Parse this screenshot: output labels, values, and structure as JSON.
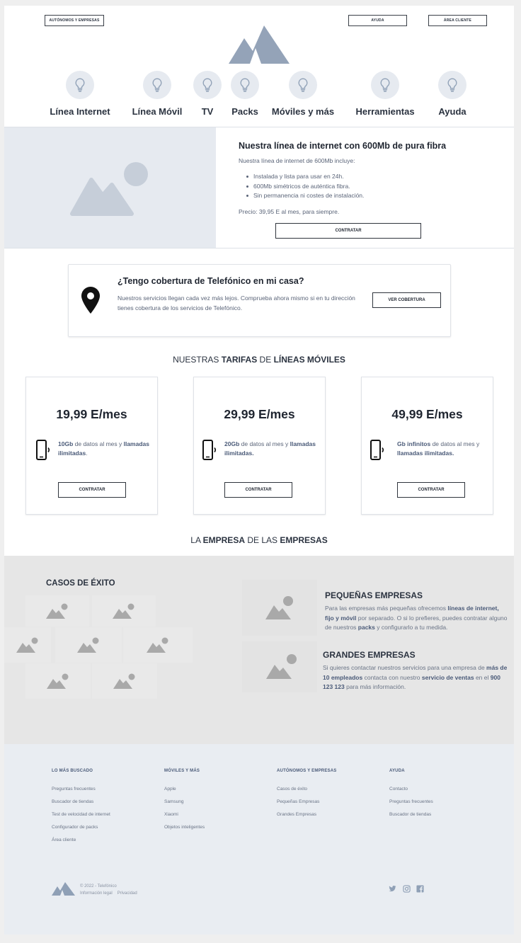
{
  "header": {
    "segment_button": "AUTÓNOMOS Y EMPRESAS",
    "help_button": "AYUDA",
    "client_area_button": "ÁREA CLIENTE",
    "logo_icon": "mountain-logo"
  },
  "nav": {
    "icon": "lightbulb-icon",
    "items": [
      {
        "label": "Línea Internet"
      },
      {
        "label": "Línea Móvil"
      },
      {
        "label": "TV"
      },
      {
        "label": "Packs"
      },
      {
        "label": "Móviles y más"
      },
      {
        "label": "Herramientas"
      },
      {
        "label": "Ayuda"
      }
    ]
  },
  "hero": {
    "image_icon": "image-placeholder-icon",
    "title": "Nuestra línea de internet con 600Mb de pura fibra",
    "intro": "Nuestra línea de internet de 600Mb incluye:",
    "bullets": [
      "Instalada y lista para usar en 24h.",
      "600Mb simétricos de auténtica fibra.",
      "Sin permanencia ni costes de instalación."
    ],
    "price": "Precio: 39,95 E al mes, para siempre.",
    "cta": "CONTRATAR"
  },
  "coverage": {
    "icon": "map-pin-icon",
    "title": "¿Tengo cobertura de Telefónico en mi casa?",
    "text": "Nuestros servicios llegan cada vez más lejos. Comprueba ahora mismo si en tu dirección tienes cobertura de los servicios de Telefónico.",
    "cta": "VER COBERTURA"
  },
  "tariffs": {
    "heading": {
      "pre": "NUESTRAS ",
      "b1": "TARIFAS",
      "mid": " DE ",
      "b2": "LÍNEAS MÓVILES"
    },
    "icon": "smartphone-signal-icon",
    "plans": [
      {
        "price": "19,99 E/mes",
        "data_bold": "10Gb",
        "data_rest": " de datos al mes y ",
        "calls_bold": "llamadas ilimitadas",
        "end": ".",
        "cta": "CONTRATAR"
      },
      {
        "price": "29,99 E/mes",
        "data_bold": "20Gb",
        "data_rest": " de datos al mes y ",
        "calls_bold": "llamadas ilimitadas.",
        "end": "",
        "cta": "CONTRATAR"
      },
      {
        "price": "49,99 E/mes",
        "data_bold": "Gb infinitos",
        "data_rest": " de datos al mes y ",
        "calls_bold": "llamadas ilimitadas.",
        "end": "",
        "cta": "CONTRATAR"
      }
    ]
  },
  "business": {
    "heading": {
      "pre": "LA ",
      "b1": "EMPRESA",
      "mid": " DE LAS ",
      "b2": "EMPRESAS"
    },
    "success_title": "CASOS DE ÉXITO",
    "small": {
      "title": "PEQUEÑAS EMPRESAS",
      "t1": "Para las empresas más pequeñas ofrecemos ",
      "b1": "líneas de internet, fijo y móvil",
      "t2": " por separado. O si lo prefieres, puedes contratar alguno de nuestros ",
      "b2": "packs",
      "t3": " y configurarlo a tu medida."
    },
    "large": {
      "title": "GRANDES EMPRESAS",
      "t1": "Si quieres contactar nuestros servicios para una empresa de ",
      "b1": "más de 10 empleados",
      "t2": " contacta con nuestro ",
      "b2": "servicio de ventas",
      "t3": " en el ",
      "b3": "900 123 123",
      "t4": " para más información."
    }
  },
  "footer": {
    "columns": [
      {
        "title": "LO MÁS BUSCADO",
        "links": [
          "Preguntas frecuentes",
          "Buscador de tiendas",
          "Test de velocidad de internet",
          "Configurador de packs",
          "Área cliente"
        ]
      },
      {
        "title": "MÓVILES Y MÁS",
        "links": [
          "Apple",
          "Samsung",
          "Xiaomi",
          "Objetos inteligentes"
        ]
      },
      {
        "title": "AUTÓNOMOS Y EMPRESAS",
        "links": [
          "Casos de éxito",
          "Pequeñas Empresas",
          "Grandes Empresas"
        ]
      },
      {
        "title": "AYUDA",
        "links": [
          "Contacto",
          "Preguntas frecuentes",
          "Buscador de tiendas"
        ]
      }
    ],
    "copyright": "© 2022 - Telefónico",
    "legal": "Información legal",
    "privacy": "Privacidad",
    "social_icons": [
      "twitter-icon",
      "instagram-icon",
      "facebook-icon"
    ]
  },
  "colors": {
    "accent": "#8fa0b6",
    "placeholder": "#c6ced9",
    "panel": "#e6eaf0",
    "footer": "#e9edf2",
    "gray_section": "#e6e6e6"
  }
}
